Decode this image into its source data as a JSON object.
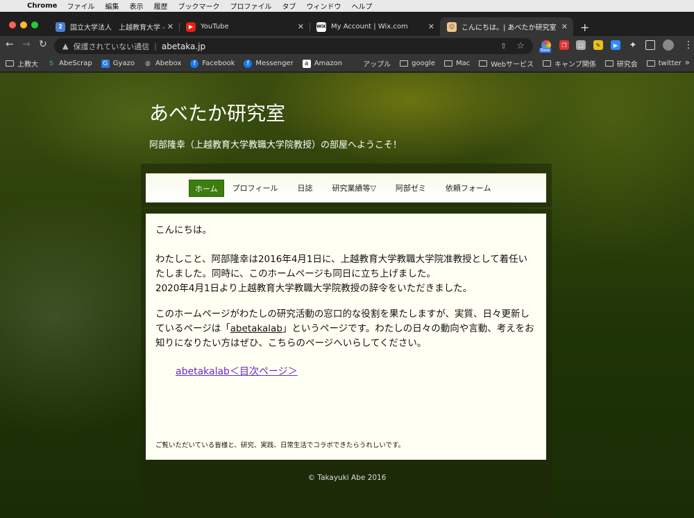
{
  "menubar": {
    "app": "Chrome",
    "items": [
      "ファイル",
      "編集",
      "表示",
      "履歴",
      "ブックマーク",
      "プロファイル",
      "タブ",
      "ウィンドウ",
      "ヘルプ"
    ]
  },
  "tabs": [
    {
      "title": "国立大学法人　上越教育大学 - カ",
      "favicon": "2",
      "color": "#4a7fd6"
    },
    {
      "title": "YouTube",
      "favicon": "▶",
      "color": "#e62117"
    },
    {
      "title": "My Account | Wix.com",
      "favicon": "WiX",
      "color": "#ffffff"
    },
    {
      "title": "こんにちは。| あべたか研究室",
      "favicon": "☺",
      "color": "#f0c890"
    }
  ],
  "toolbar": {
    "security": "保護されていない通信",
    "url": "abetaka.jp",
    "ext_badge": "New"
  },
  "bookmarks": [
    {
      "label": "上教大",
      "icon": "folder"
    },
    {
      "label": "AbeScrap",
      "icon": "S"
    },
    {
      "label": "Gyazo",
      "icon": "G"
    },
    {
      "label": "Abebox",
      "icon": "globe"
    },
    {
      "label": "Facebook",
      "icon": "f"
    },
    {
      "label": "Messenger",
      "icon": "f"
    },
    {
      "label": "Amazon",
      "icon": "a"
    },
    {
      "label": "アップル",
      "icon": "apple"
    },
    {
      "label": "google",
      "icon": "folder"
    },
    {
      "label": "Mac",
      "icon": "folder"
    },
    {
      "label": "Webサービス",
      "icon": "folder"
    },
    {
      "label": "キャンプ関係",
      "icon": "folder"
    },
    {
      "label": "研究会",
      "icon": "folder"
    },
    {
      "label": "twitter",
      "icon": "folder"
    }
  ],
  "site": {
    "title": "あべたか研究室",
    "subtitle": "阿部隆幸（上越教育大学教職大学院教授）の部屋へようこそ！",
    "nav": [
      {
        "label": "ホーム",
        "active": true
      },
      {
        "label": "プロフィール",
        "active": false
      },
      {
        "label": "日誌",
        "active": false
      },
      {
        "label": "研究業績等▽",
        "active": false
      },
      {
        "label": "阿部ゼミ",
        "active": false
      },
      {
        "label": "依頼フォーム",
        "active": false
      }
    ],
    "greeting": "こんにちは。",
    "para1_line1": "わたしこと、阿部隆幸は2016年4月1日に、上越教育大学教職大学院准教授として着任いたしました。同時に、このホームページも同日に立ち上げました。",
    "para1_line2": "2020年4月1日より上越教育大学教職大学院教授の辞令をいただきました。",
    "para2_before": "このホームページがわたしの研究活動の窓口的な役割を果たしますが、実質、日々更新しているページは「",
    "para2_link": "abetakalab",
    "para2_after": "」というページです。わたしの日々の動向や言動、考えをお知りになりたい方はぜひ、こちらのページへいらしてください。",
    "toc_link": "abetakalab＜目次ページ＞",
    "footer_note": "ご覧いただいている皆様と、研究、実践、日常生活でコラボできたらうれしいです。",
    "copyright": "© Takayuki Abe 2016"
  }
}
